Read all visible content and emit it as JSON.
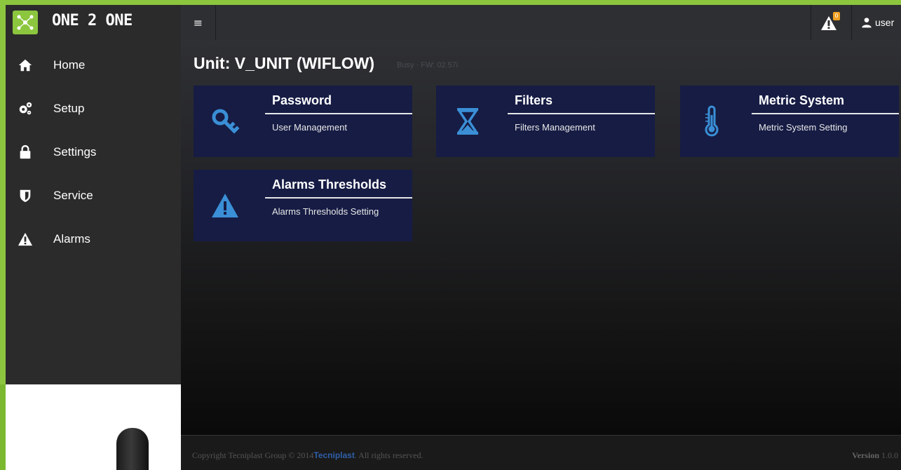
{
  "app": {
    "brand": "ONE 2 ONE",
    "accent": "#8cc63f",
    "tile_color": "#161c44",
    "icon_color": "#3a8fd6"
  },
  "sidebar": {
    "items": [
      {
        "label": "Home",
        "icon": "home-icon"
      },
      {
        "label": "Setup",
        "icon": "gears-icon"
      },
      {
        "label": "Settings",
        "icon": "lock-icon"
      },
      {
        "label": "Service",
        "icon": "shield-icon"
      },
      {
        "label": "Alarms",
        "icon": "warning-icon"
      }
    ]
  },
  "topbar": {
    "menu_glyph": "≡",
    "alarm_count": "0",
    "user": "user"
  },
  "main": {
    "title": "Unit: V_UNIT (WIFLOW)",
    "status": "Busy · FW: 02.57i",
    "tiles": [
      {
        "title": "Password",
        "desc": "User Management",
        "icon": "key-icon"
      },
      {
        "title": "Filters",
        "desc": "Filters Management",
        "icon": "hourglass-icon"
      },
      {
        "title": "Metric System",
        "desc": "Metric System Setting",
        "icon": "thermometer-icon"
      },
      {
        "title": "Alarms Thresholds",
        "desc": "Alarms Thresholds Setting",
        "icon": "warning-icon"
      }
    ]
  },
  "footer": {
    "copyright": "Copyright Tecniplast Group © 2014",
    "company": "Tecniplast",
    "rights": ". All rights reserved.",
    "version_label": "Version",
    "version": "1.0.0"
  }
}
